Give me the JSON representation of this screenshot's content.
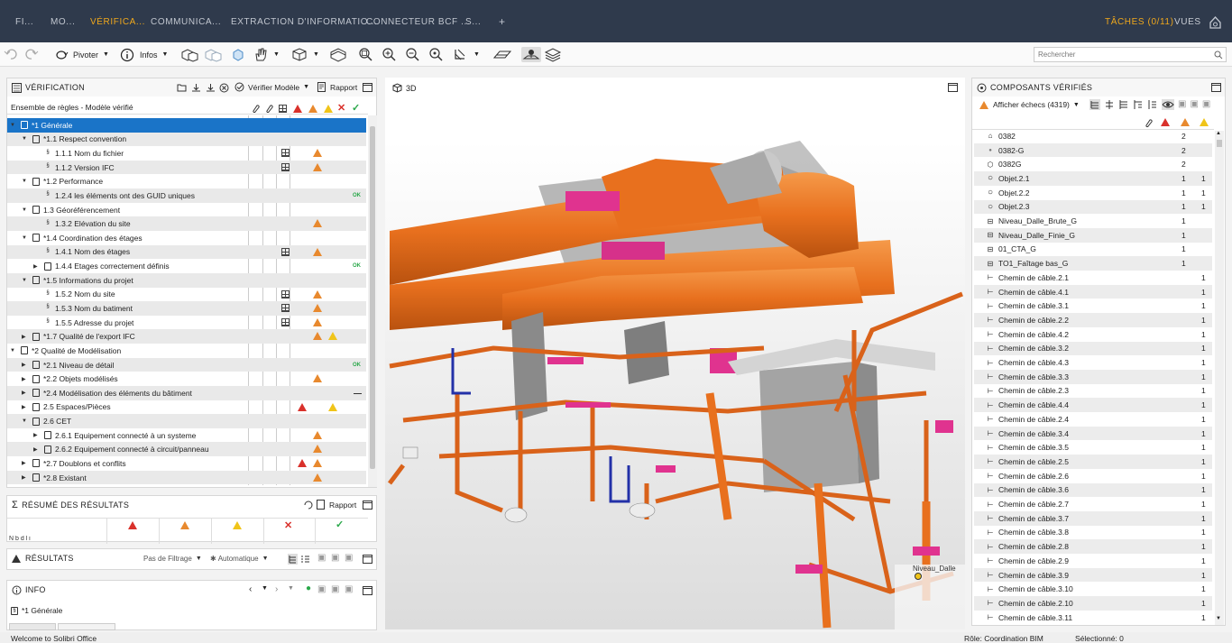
{
  "topbar": {
    "tabs": [
      "FI...",
      "MO...",
      "VÉRIFICA...",
      "COMMUNICA...",
      "EXTRACTION D'INFORMATIO...",
      "CONNECTEUR BCF ...",
      "S..."
    ],
    "plus": "+",
    "tasks": "TÂCHES (0/11)",
    "views": "VUES"
  },
  "toolbar": {
    "rotate": "Pivoter",
    "info": "Infos",
    "search_placeholder": "Rechercher"
  },
  "verification": {
    "title": "VÉRIFICATION",
    "check_model": "Vérifier Modèle",
    "report": "Rapport",
    "ruleset_label": "Ensemble de règles - Modèle vérifié",
    "rows": [
      {
        "label": "*1 Générale",
        "level": 0,
        "selected": true
      },
      {
        "label": "*1.1 Respect convention",
        "level": 1
      },
      {
        "label": "1.1.1 Nom du fichier",
        "level": 2
      },
      {
        "label": "1.1.2 Version IFC",
        "level": 2
      },
      {
        "label": "*1.2 Performance",
        "level": 1
      },
      {
        "label": "1.2.4 les éléments ont des GUID uniques",
        "level": 2,
        "ok": "OK"
      },
      {
        "label": "1.3 Géoréférencement",
        "level": 1
      },
      {
        "label": "1.3.2 Elévation du site",
        "level": 2
      },
      {
        "label": "*1.4 Coordination des étages",
        "level": 1
      },
      {
        "label": "1.4.1 Nom des étages",
        "level": 2
      },
      {
        "label": "1.4.4 Etages correctement définis",
        "level": 2,
        "ok": "OK"
      },
      {
        "label": "*1.5 Informations du projet",
        "level": 1
      },
      {
        "label": "1.5.2 Nom du site",
        "level": 2
      },
      {
        "label": "1.5.3 Nom du batiment",
        "level": 2
      },
      {
        "label": "1.5.5 Adresse du projet",
        "level": 2
      },
      {
        "label": "*1.7 Qualité de l'export IFC",
        "level": 1
      },
      {
        "label": "*2 Qualité de Modélisation",
        "level": 0
      },
      {
        "label": "*2.1 Niveau de détail",
        "level": 1,
        "ok": "OK"
      },
      {
        "label": "*2.2 Objets modélisés",
        "level": 1
      },
      {
        "label": "*2.4 Modélisation des éléments du bâtiment",
        "level": 1
      },
      {
        "label": "2.5 Espaces/Pièces",
        "level": 1
      },
      {
        "label": "2.6 CET",
        "level": 1
      },
      {
        "label": "2.6.1 Equipement connecté à un systeme",
        "level": 2
      },
      {
        "label": "2.6.2 Equipement connecté à circuit/panneau",
        "level": 2
      },
      {
        "label": "*2.7 Doublons et conflits",
        "level": 1
      },
      {
        "label": "*2.8 Existant",
        "level": 1
      }
    ]
  },
  "summary": {
    "title": "RÉSUMÉ DES RÉSULTATS",
    "report": "Rapport",
    "cut_text": "N  b       d     l   i"
  },
  "results": {
    "title": "RÉSULTATS",
    "filter": "Pas de Filtrage",
    "auto": "Automatique"
  },
  "info": {
    "title": "INFO",
    "item": "*1 Générale"
  },
  "view3d": {
    "title": "3D",
    "level_label": "Niveau_Dalle"
  },
  "components": {
    "title": "COMPOSANTS VÉRIFIÉS",
    "filter": "Afficher échecs (4319)",
    "rows": [
      {
        "name": "0382",
        "c1": "2",
        "c2": ""
      },
      {
        "name": "0382-G",
        "c1": "2",
        "c2": ""
      },
      {
        "name": "0382G",
        "c1": "2",
        "c2": ""
      },
      {
        "name": "Objet.2.1",
        "c1": "1",
        "c2": "1"
      },
      {
        "name": "Objet.2.2",
        "c1": "1",
        "c2": "1"
      },
      {
        "name": "Objet.2.3",
        "c1": "1",
        "c2": "1"
      },
      {
        "name": "Niveau_Dalle_Brute_G",
        "c1": "1",
        "c2": ""
      },
      {
        "name": "Niveau_Dalle_Finie_G",
        "c1": "1",
        "c2": ""
      },
      {
        "name": "01_CTA_G",
        "c1": "1",
        "c2": ""
      },
      {
        "name": "TO1_Faîtage bas_G",
        "c1": "1",
        "c2": ""
      },
      {
        "name": "Chemin de câble.2.1",
        "c1": "",
        "c2": "1"
      },
      {
        "name": "Chemin de câble.4.1",
        "c1": "",
        "c2": "1"
      },
      {
        "name": "Chemin de câble.3.1",
        "c1": "",
        "c2": "1"
      },
      {
        "name": "Chemin de câble.2.2",
        "c1": "",
        "c2": "1"
      },
      {
        "name": "Chemin de câble.4.2",
        "c1": "",
        "c2": "1"
      },
      {
        "name": "Chemin de câble.3.2",
        "c1": "",
        "c2": "1"
      },
      {
        "name": "Chemin de câble.4.3",
        "c1": "",
        "c2": "1"
      },
      {
        "name": "Chemin de câble.3.3",
        "c1": "",
        "c2": "1"
      },
      {
        "name": "Chemin de câble.2.3",
        "c1": "",
        "c2": "1"
      },
      {
        "name": "Chemin de câble.4.4",
        "c1": "",
        "c2": "1"
      },
      {
        "name": "Chemin de câble.2.4",
        "c1": "",
        "c2": "1"
      },
      {
        "name": "Chemin de câble.3.4",
        "c1": "",
        "c2": "1"
      },
      {
        "name": "Chemin de câble.3.5",
        "c1": "",
        "c2": "1"
      },
      {
        "name": "Chemin de câble.2.5",
        "c1": "",
        "c2": "1"
      },
      {
        "name": "Chemin de câble.2.6",
        "c1": "",
        "c2": "1"
      },
      {
        "name": "Chemin de câble.3.6",
        "c1": "",
        "c2": "1"
      },
      {
        "name": "Chemin de câble.2.7",
        "c1": "",
        "c2": "1"
      },
      {
        "name": "Chemin de câble.3.7",
        "c1": "",
        "c2": "1"
      },
      {
        "name": "Chemin de câble.3.8",
        "c1": "",
        "c2": "1"
      },
      {
        "name": "Chemin de câble.2.8",
        "c1": "",
        "c2": "1"
      },
      {
        "name": "Chemin de câble.2.9",
        "c1": "",
        "c2": "1"
      },
      {
        "name": "Chemin de câble.3.9",
        "c1": "",
        "c2": "1"
      },
      {
        "name": "Chemin de câble.3.10",
        "c1": "",
        "c2": "1"
      },
      {
        "name": "Chemin de câble.2.10",
        "c1": "",
        "c2": "1"
      },
      {
        "name": "Chemin de câble.3.11",
        "c1": "",
        "c2": "1"
      }
    ]
  },
  "status": {
    "welcome": "Welcome to Solibri Office",
    "role": "Rôle: Coordination BIM",
    "selected": "Sélectionné: 0"
  },
  "colors": {
    "topbar": "#2f3a4c",
    "accent": "#f0a81c",
    "selection": "#1a74c8",
    "pipe": "#e8701e"
  }
}
